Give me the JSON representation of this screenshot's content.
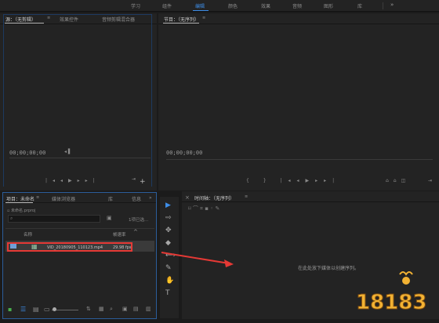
{
  "workspace_tabs": {
    "learn": "学习",
    "assembly": "组件",
    "editing": "编辑",
    "color": "颜色",
    "effects": "效果",
    "audio": "音频",
    "graphics": "图形",
    "libraries": "库",
    "more": "»"
  },
  "source_panel": {
    "tab_source": "源：（无剪辑）",
    "tab_effect_controls": "效果控件",
    "tab_audio_mixer": "音频剪辑混合器",
    "timecode": "00;00;00;00"
  },
  "program_panel": {
    "title": "节目：（无序列）",
    "timecode": "00;00;00;00"
  },
  "project_panel": {
    "tab_project": "项目：未命名",
    "tab_media_browser": "媒体浏览器",
    "tab_libraries": "库",
    "tab_info": "信息",
    "tab_more": "»",
    "breadcrumb": "未命名.prproj",
    "selection_count": "1项已选...",
    "col_name": "名称",
    "col_framerate": "帧速率",
    "item": {
      "filename": "VID_20180905_110123.mp4",
      "framerate": "29.98 fps"
    }
  },
  "timeline_panel": {
    "title": "时间轴：（无序列）",
    "hint": "在此处放下媒体以创建序列。"
  },
  "watermark": {
    "text": "18183"
  },
  "colors": {
    "accent_blue": "#3e8ee8",
    "highlight_red": "#e53935"
  }
}
